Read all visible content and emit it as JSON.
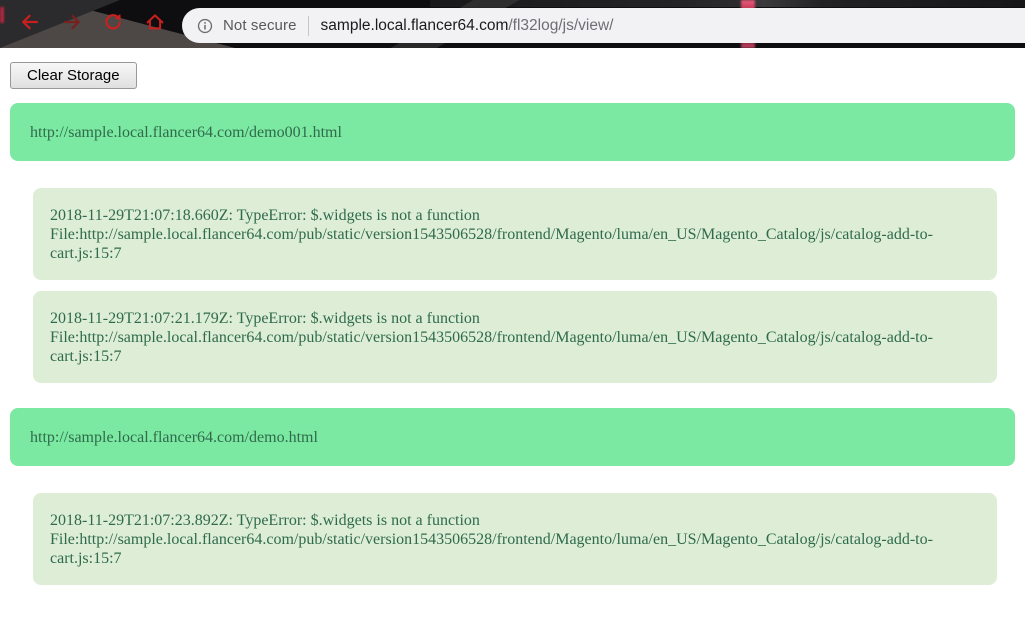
{
  "browser": {
    "security_label": "Not secure",
    "url_domain": "sample.local.flancer64.com",
    "url_path": "/fl32log/js/view/",
    "icons": {
      "back": "left-arrow",
      "forward": "right-arrow",
      "reload": "circular-arrow",
      "home": "house",
      "info": "circled-i"
    }
  },
  "toolbar": {
    "clear_button_label": "Clear Storage"
  },
  "log": {
    "groups": [
      {
        "source_url": "http://sample.local.flancer64.com/demo001.html",
        "entries": [
          {
            "message": "2018-11-29T21:07:18.660Z: TypeError: $.widgets is not a function",
            "file": "File:http://sample.local.flancer64.com/pub/static/version1543506528/frontend/Magento/luma/en_US/Magento_Catalog/js/catalog-add-to-cart.js:15:7"
          },
          {
            "message": "2018-11-29T21:07:21.179Z: TypeError: $.widgets is not a function",
            "file": "File:http://sample.local.flancer64.com/pub/static/version1543506528/frontend/Magento/luma/en_US/Magento_Catalog/js/catalog-add-to-cart.js:15:7"
          }
        ]
      },
      {
        "source_url": "http://sample.local.flancer64.com/demo.html",
        "entries": [
          {
            "message": "2018-11-29T21:07:23.892Z: TypeError: $.widgets is not a function",
            "file": "File:http://sample.local.flancer64.com/pub/static/version1543506528/frontend/Magento/luma/en_US/Magento_Catalog/js/catalog-add-to-cart.js:15:7"
          }
        ]
      }
    ]
  },
  "colors": {
    "group_header_green": "#7ce9a2",
    "entry_green": "#ddedd6",
    "log_text_green": "#2f6b4b",
    "chrome_icon_red": "#c9201f",
    "chrome_bg": "#0e0e10",
    "address_bar_bg": "#f2f2f4",
    "pink_streak": "#ef5b7d"
  }
}
